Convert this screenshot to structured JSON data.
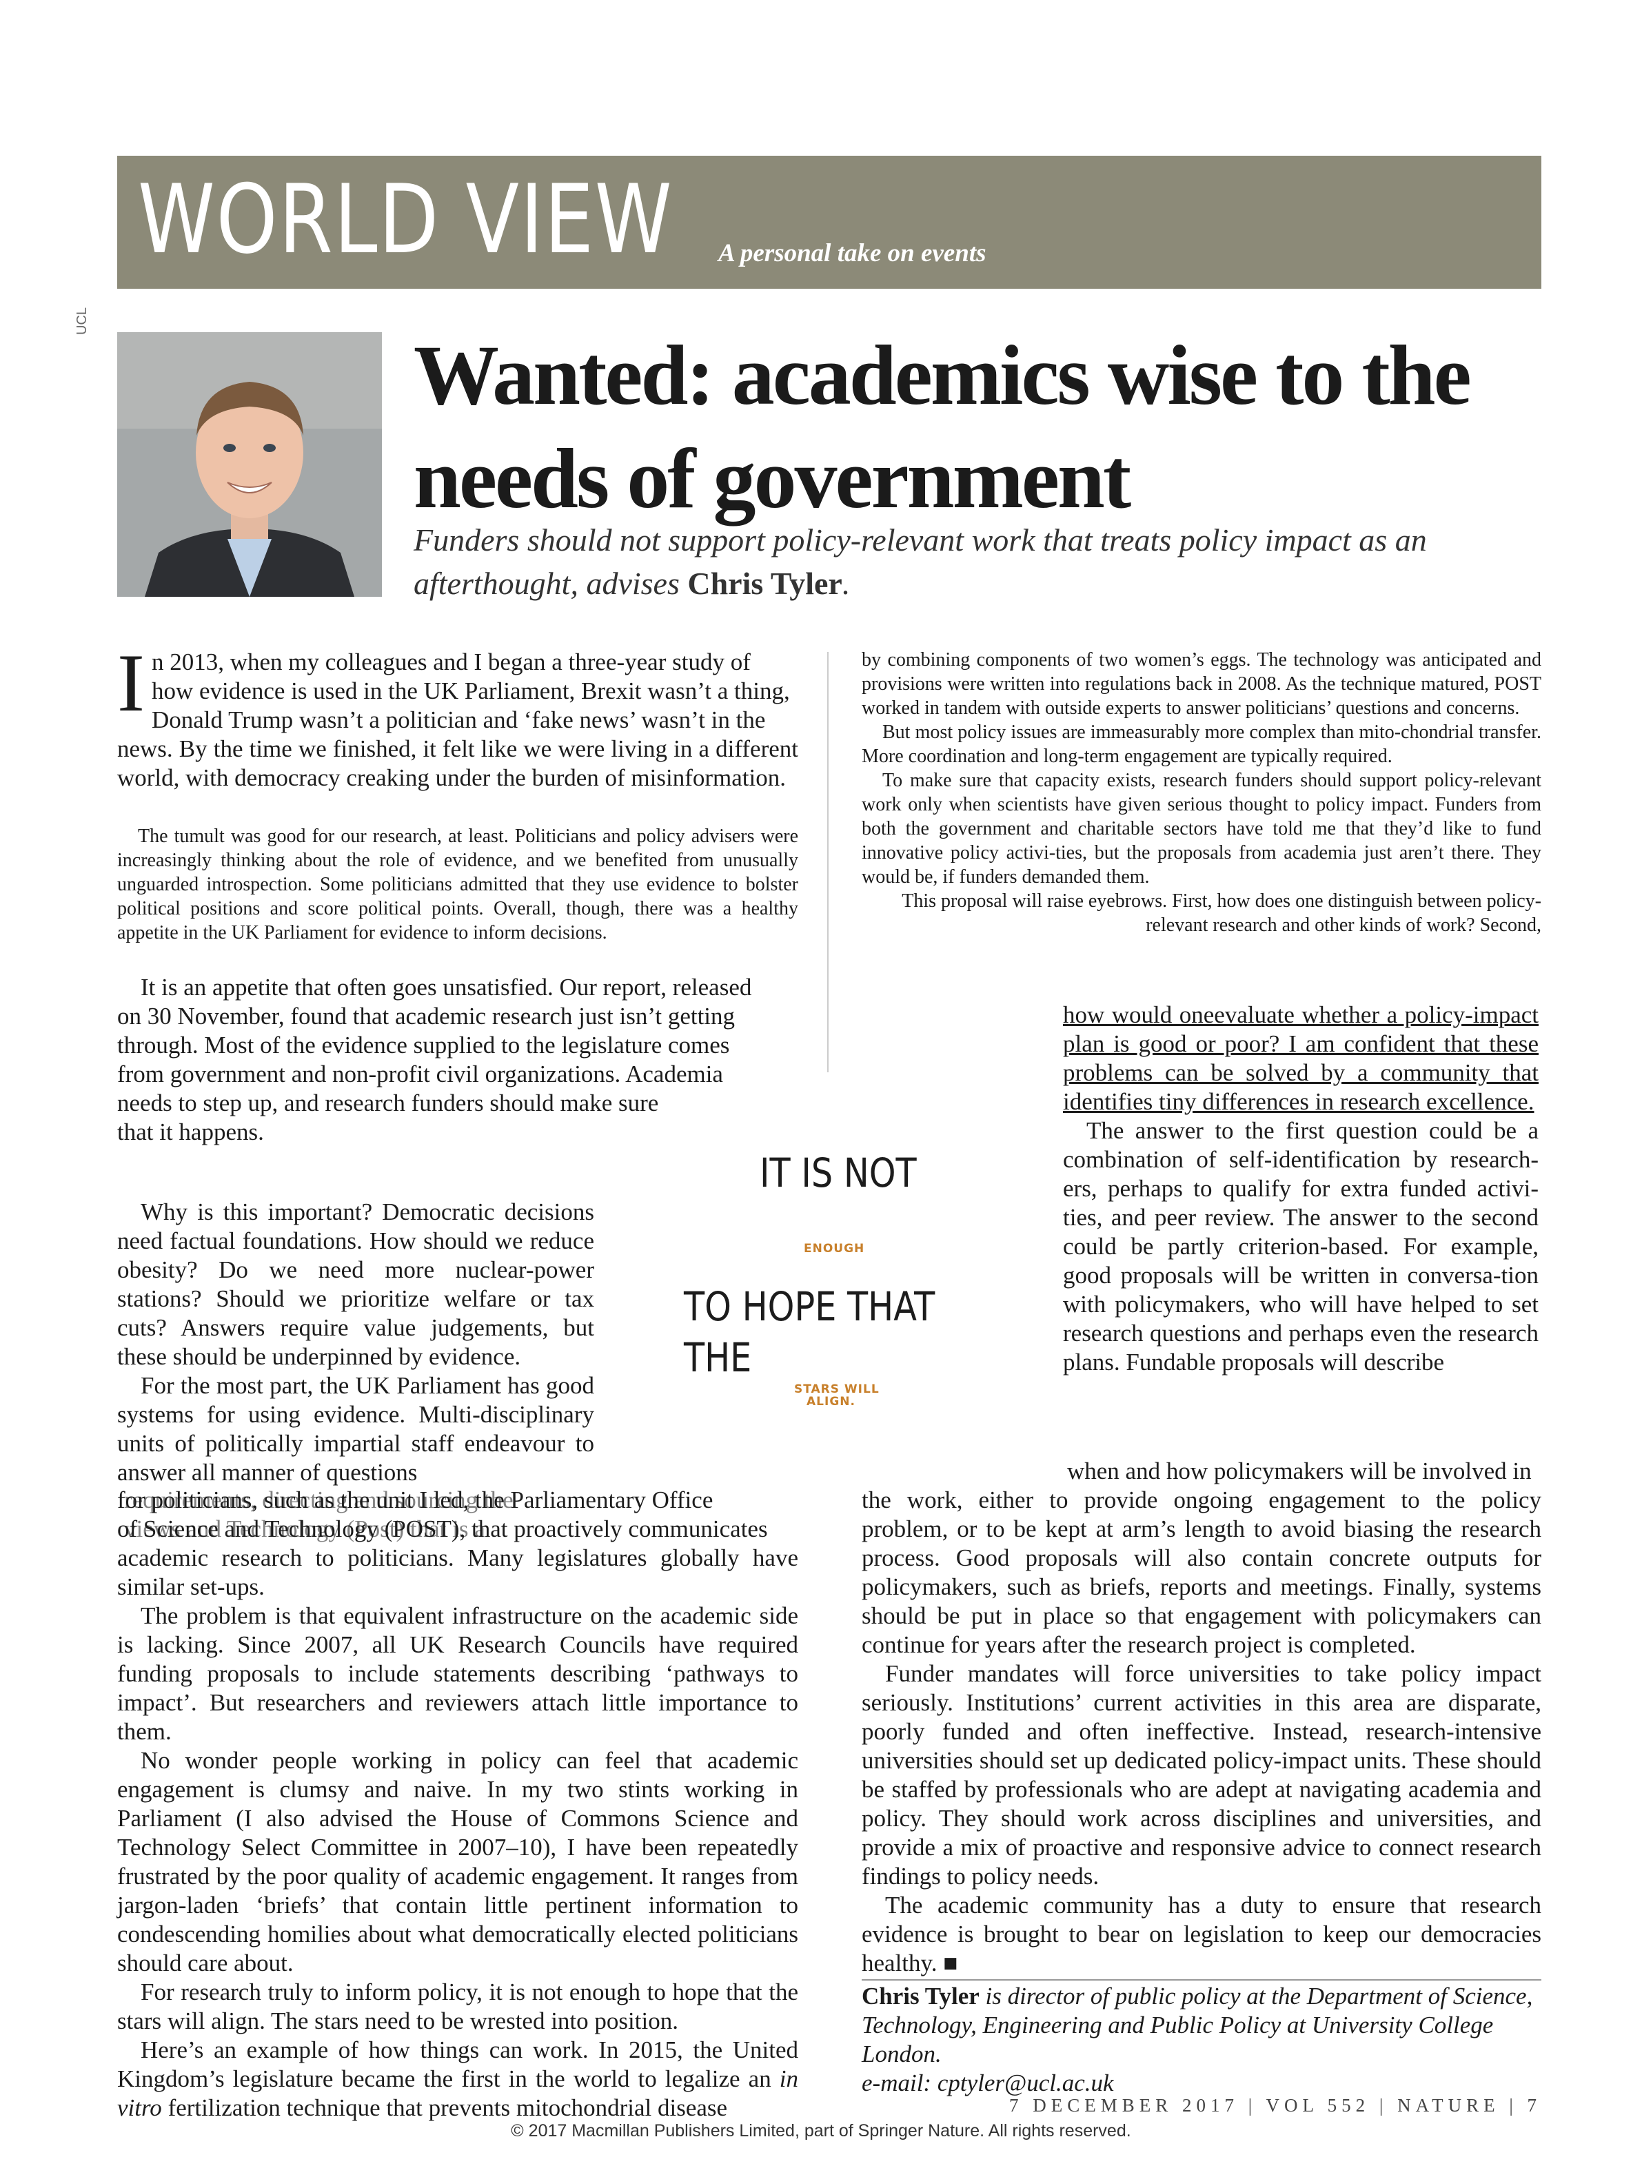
{
  "banner": {
    "title": "WORLD VIEW",
    "tagline": "A personal take on events",
    "color": "#8c8a78"
  },
  "photo_credit": "UCL",
  "headline": "Wanted: academics wise to the needs of government",
  "deck": {
    "text": "Funders should not support policy-relevant work that treats policy impact as an afterthought, advises ",
    "author": "Chris Tyler",
    "end": "."
  },
  "left_column": {
    "dropcap": "I",
    "p1_lines": [
      "n 2013, when my colleagues and I began a three-year study of",
      "how evidence is used in the UK Parliament, Brexit wasn’t a thing,",
      "Donald Trump wasn’t a politician and ‘fake news’ wasn’t in the"
    ],
    "p1_rest": "news. By the time we finished, it felt like we were living in a different world, with democracy creaking under the burden of misinformation.",
    "p2": "The tumult was good for our research, at least. Politicians and policy advisers were increasingly thinking about the role of evidence, and we benefited from unusually unguarded introspection. Some politicians admitted that they use evidence to bolster political positions and score political points. Overall, though, there was a healthy appetite in the UK Parliament for evidence to inform decisions.",
    "p3": "It is an appetite that often goes unsatisfied. Our report, released on 30 November, found that academic research just isn’t getting through. Most of the evidence supplied to the legislature comes from government and non-profit civil organizations. Academia needs to step up, and research funders should make sure",
    "p3_end": "that it happens.",
    "p4": "Why is this important? Democratic decisions need factual foundations. How should we reduce obesity? Do we need more nuclear-power stations? Should we prioritize welfare or tax cuts? Answers require value judgements, but these should be underpinned by evidence.",
    "p5": "For the most part, the UK Parliament has good systems for using evidence. Multi-disciplinary units of politically impartial staff endeavour to answer all manner of questions",
    "p5_overlap_a": "for politicians, such as the unit I led, the Parliamentary Office",
    "p5_overlap_b": "of Science and Technology (POST), that proactively communicates",
    "p5_ghost_a": "requirements, directing and sourcing the",
    "p5_ghost_b": "views and Technology (Post) that is a",
    "p5_rest": "academic research to politicians. Many legislatures globally have similar set-ups.",
    "p6": "The problem is that equivalent infrastructure on the academic side is lacking. Since 2007, all UK Research Councils have required funding proposals to include statements describing ‘pathways to impact’. But researchers and reviewers attach little importance to them.",
    "p7": "No wonder people working in policy can feel that academic engagement is clumsy and naive. In my two stints working in Parliament (I also advised the House of Commons Science and Technology Select Committee in 2007–10), I have been repeatedly frustrated by the poor quality of academic engagement. It ranges from jargon-laden ‘briefs’ that contain little pertinent information to condescending homilies about what democratically elected politicians should care about.",
    "p8": "For research truly to inform policy, it is not enough to hope that the stars will align. The stars need to be wrested into position.",
    "p9": "Here’s an example of how things can work. In 2015, the United Kingdom’s legislature became the first in the world to legalize an",
    "p9_italic": "in vitro",
    "p9_rest": " fertilization technique that prevents mitochondrial disease"
  },
  "right_top": {
    "p1": "by combining components of two women’s eggs. The technology was anticipated and provisions were written into regulations back in 2008. As the technique matured, POST worked in tandem with outside experts to answer politicians’ questions and concerns.",
    "p2": "But most policy issues are immeasurably more complex than mito-chondrial transfer. More coordination and long-term engagement are typically required.",
    "p3": "To make sure that capacity exists, research funders should support policy-relevant work only when scientists have given serious thought to policy impact. Funders from both the government and charitable sectors have told me that they’d like to fund innovative policy activi-ties, but the proposals from academia just aren’t there. They would be, if funders demanded them.",
    "p4": "This proposal will raise eyebrows. First, how does one distinguish between policy-relevant research and other kinds of work? Second,"
  },
  "right_narrow": {
    "p1": "how would oneevaluate whether a policy-impact plan is good or poor? I am confident that these problems can be solved by a community that identifies tiny differences in research excellence.",
    "p2": "The answer to the first question could be a combination of self-identification by research-ers, perhaps to qualify for extra funded activi-ties, and peer review. The answer to the second could be partly criterion-based. For example, good proposals will be written in conversa-tion with policymakers, who will have helped to set research questions and perhaps even the research plans. Fundable proposals will describe"
  },
  "right_bottom": {
    "p0": "when and how policymakers will be involved in",
    "p1": "the work, either to provide ongoing engagement to the policy problem, or to be kept at arm’s length to avoid biasing the research process. Good proposals will also contain concrete outputs for policymakers, such as briefs, reports and meetings. Finally, systems should be put in place so that engagement with policymakers can continue for years after the research project is completed.",
    "p2": "Funder mandates will force universities to take policy impact seriously. Institutions’ current activities in this area are disparate, poorly funded and often ineffective. Instead, research-intensive universities should set up dedicated policy-impact units. These should be staffed by professionals who are adept at navigating academia and policy. They should work across disciplines and universities, and provide a mix of proactive and responsive advice to connect research findings to policy needs.",
    "p3": "The academic community has a duty to ensure that research evidence is brought to bear on legislation to keep our democracies healthy.",
    "end_mark": "■"
  },
  "pull_quote": {
    "line1": "IT IS NOT",
    "word2": "ENOUGH",
    "line3": "TO HOPE THAT",
    "line4": "THE",
    "word5": "STARS WILL",
    "word6": "ALIGN.",
    "accent_color": "#c8802b"
  },
  "bio": {
    "name": "Chris Tyler",
    "text": " is director of public policy at the Department of Science, Technology, Engineering and Public Policy at University College London.",
    "email": "e-mail: cptyler@ucl.ac.uk"
  },
  "folio": "7 DECEMBER 2017 | VOL 552 | NATURE | 7",
  "copyright": "© 2017 Macmillan Publishers Limited, part of Springer Nature. All rights reserved."
}
